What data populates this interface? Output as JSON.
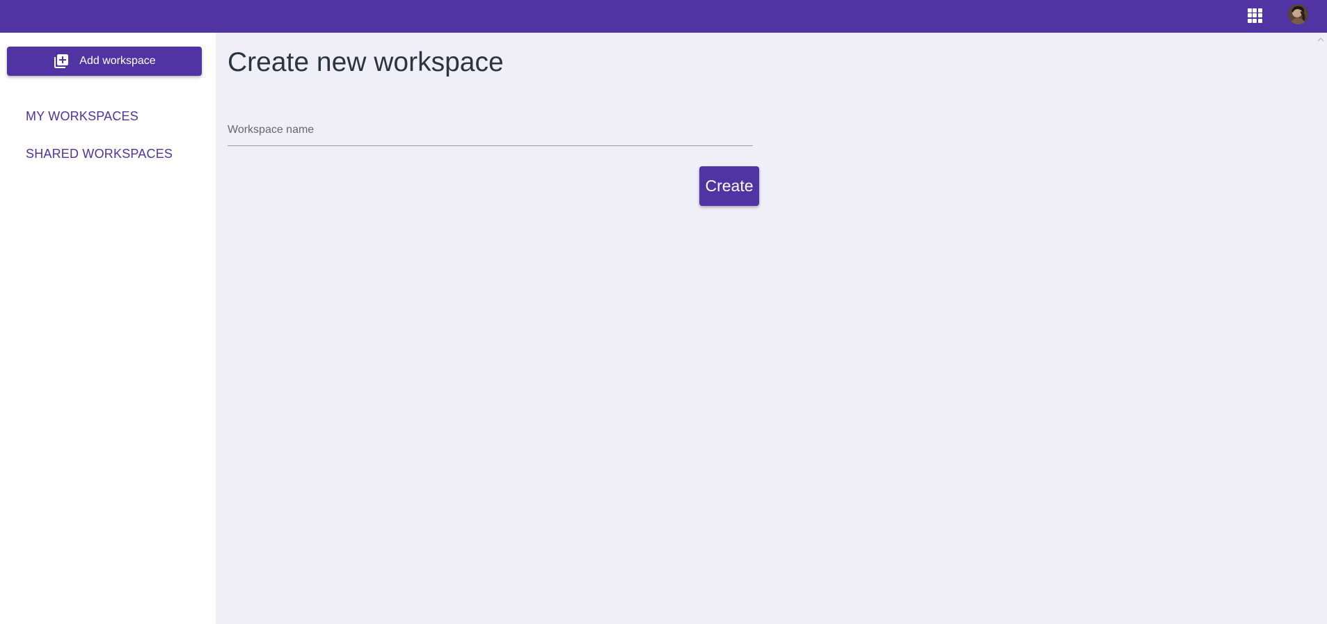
{
  "header": {
    "apps_icon": "apps-grid-icon",
    "avatar_icon": "user-avatar"
  },
  "sidebar": {
    "add_button_label": "Add workspace",
    "add_button_icon": "library-add-icon",
    "items": [
      {
        "label": "MY WORKSPACES"
      },
      {
        "label": "SHARED WORKSPACES"
      }
    ]
  },
  "main": {
    "title": "Create new workspace",
    "workspace_name_placeholder": "Workspace name",
    "workspace_name_value": "",
    "create_label": "Create"
  },
  "colors": {
    "primary": "#5034a3",
    "background": "#f0eff8",
    "sidebar_bg": "#ffffff",
    "nav_text": "#4a35a0",
    "title_text": "#2b3440"
  }
}
